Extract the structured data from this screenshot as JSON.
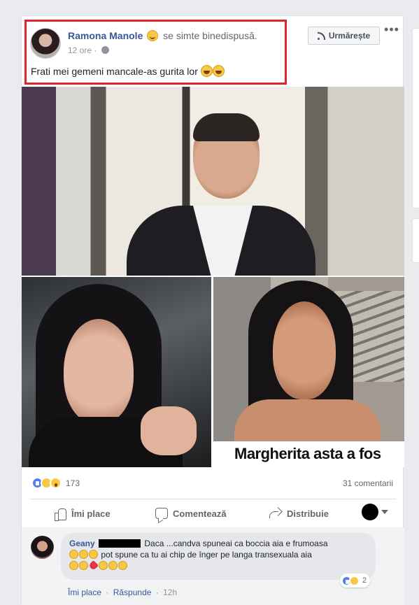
{
  "post": {
    "author": "Ramona Manole",
    "feeling_text": "se simte binedispusă.",
    "time": "12 ore",
    "text": "Frati mei gemeni mancale-as gurita lor",
    "follow_label": "Urmărește",
    "more_label": "•••",
    "photo_caption": "Margherita asta a fos"
  },
  "stats": {
    "reactions_count": "173",
    "comments_label": "31 comentarii"
  },
  "actions": {
    "like_label": "Îmi place",
    "comment_label": "Comentează",
    "share_label": "Distribuie"
  },
  "comment": {
    "author": "Geany",
    "text_part1": "Daca ...candva spuneai ca boccia aia e frumoasa",
    "text_part2": "pot spune ca tu ai chip de înger pe langa transexuala aia",
    "reaction_count": "2",
    "like_label": "Îmi place",
    "reply_label": "Răspunde",
    "time": "12h",
    "separator": "·"
  },
  "colors": {
    "highlight": "#e0242b",
    "link": "#385898",
    "like_reaction": "#4f7ff0",
    "haha_reaction": "#f7c843"
  },
  "icons": [
    "feeling-happy-icon",
    "globe-icon",
    "rss-icon",
    "more-icon",
    "like-icon",
    "comment-icon",
    "share-icon",
    "caret-down-icon",
    "laugh-emoji-icon",
    "heart-emoji-icon",
    "kiss-emoji-icon"
  ]
}
